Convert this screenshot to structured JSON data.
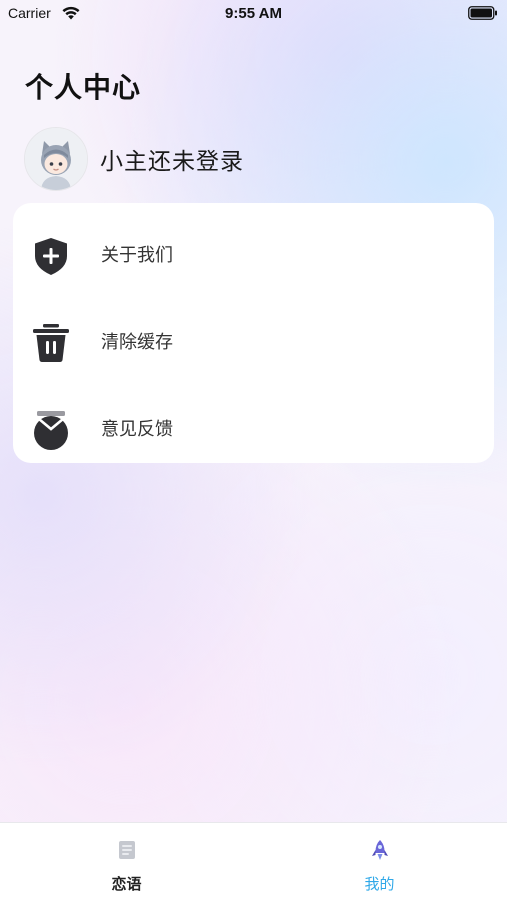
{
  "status_bar": {
    "carrier": "Carrier",
    "time": "9:55 AM"
  },
  "header": {
    "title": "个人中心"
  },
  "profile": {
    "name": "小主还未登录"
  },
  "menu": {
    "items": [
      {
        "label": "关于我们",
        "icon": "shield-plus-icon"
      },
      {
        "label": "清除缓存",
        "icon": "trash-icon"
      },
      {
        "label": "意见反馈",
        "icon": "feedback-icon"
      }
    ]
  },
  "tab_bar": {
    "tabs": [
      {
        "label": "恋语",
        "icon": "notebook-icon",
        "active": false,
        "color": "#222222"
      },
      {
        "label": "我的",
        "icon": "rocket-icon",
        "active": true,
        "color": "#2fa8e8"
      }
    ]
  }
}
